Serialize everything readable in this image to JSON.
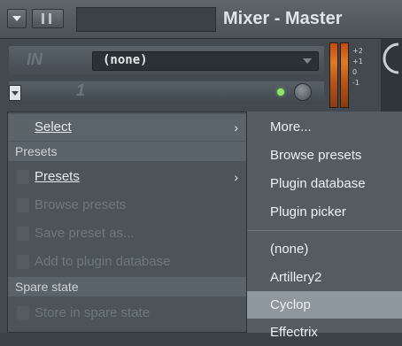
{
  "window": {
    "title": "Mixer - Master"
  },
  "insert": {
    "in_label": "IN",
    "preset_value": "(none)",
    "slot_number": "1"
  },
  "meter": {
    "scale": [
      "+2",
      "+1",
      "0",
      "-1"
    ]
  },
  "menu": {
    "select": "Select",
    "presets_header": "Presets",
    "presets": "Presets",
    "browse_presets": "Browse presets",
    "save_preset_as": "Save preset as...",
    "add_to_plugin_database": "Add to plugin database",
    "spare_state_header": "Spare state",
    "store_in_spare_state": "Store in spare state"
  },
  "submenu": {
    "more": "More...",
    "browse_presets": "Browse presets",
    "plugin_database": "Plugin database",
    "plugin_picker": "Plugin picker",
    "none": "(none)",
    "artillery2": "Artillery2",
    "cyclop": "Cyclop",
    "effectrix": "Effectrix"
  },
  "colors": {
    "accent_led": "#8fe36a",
    "meter": "#e07b20",
    "highlight": "#8e979d"
  }
}
